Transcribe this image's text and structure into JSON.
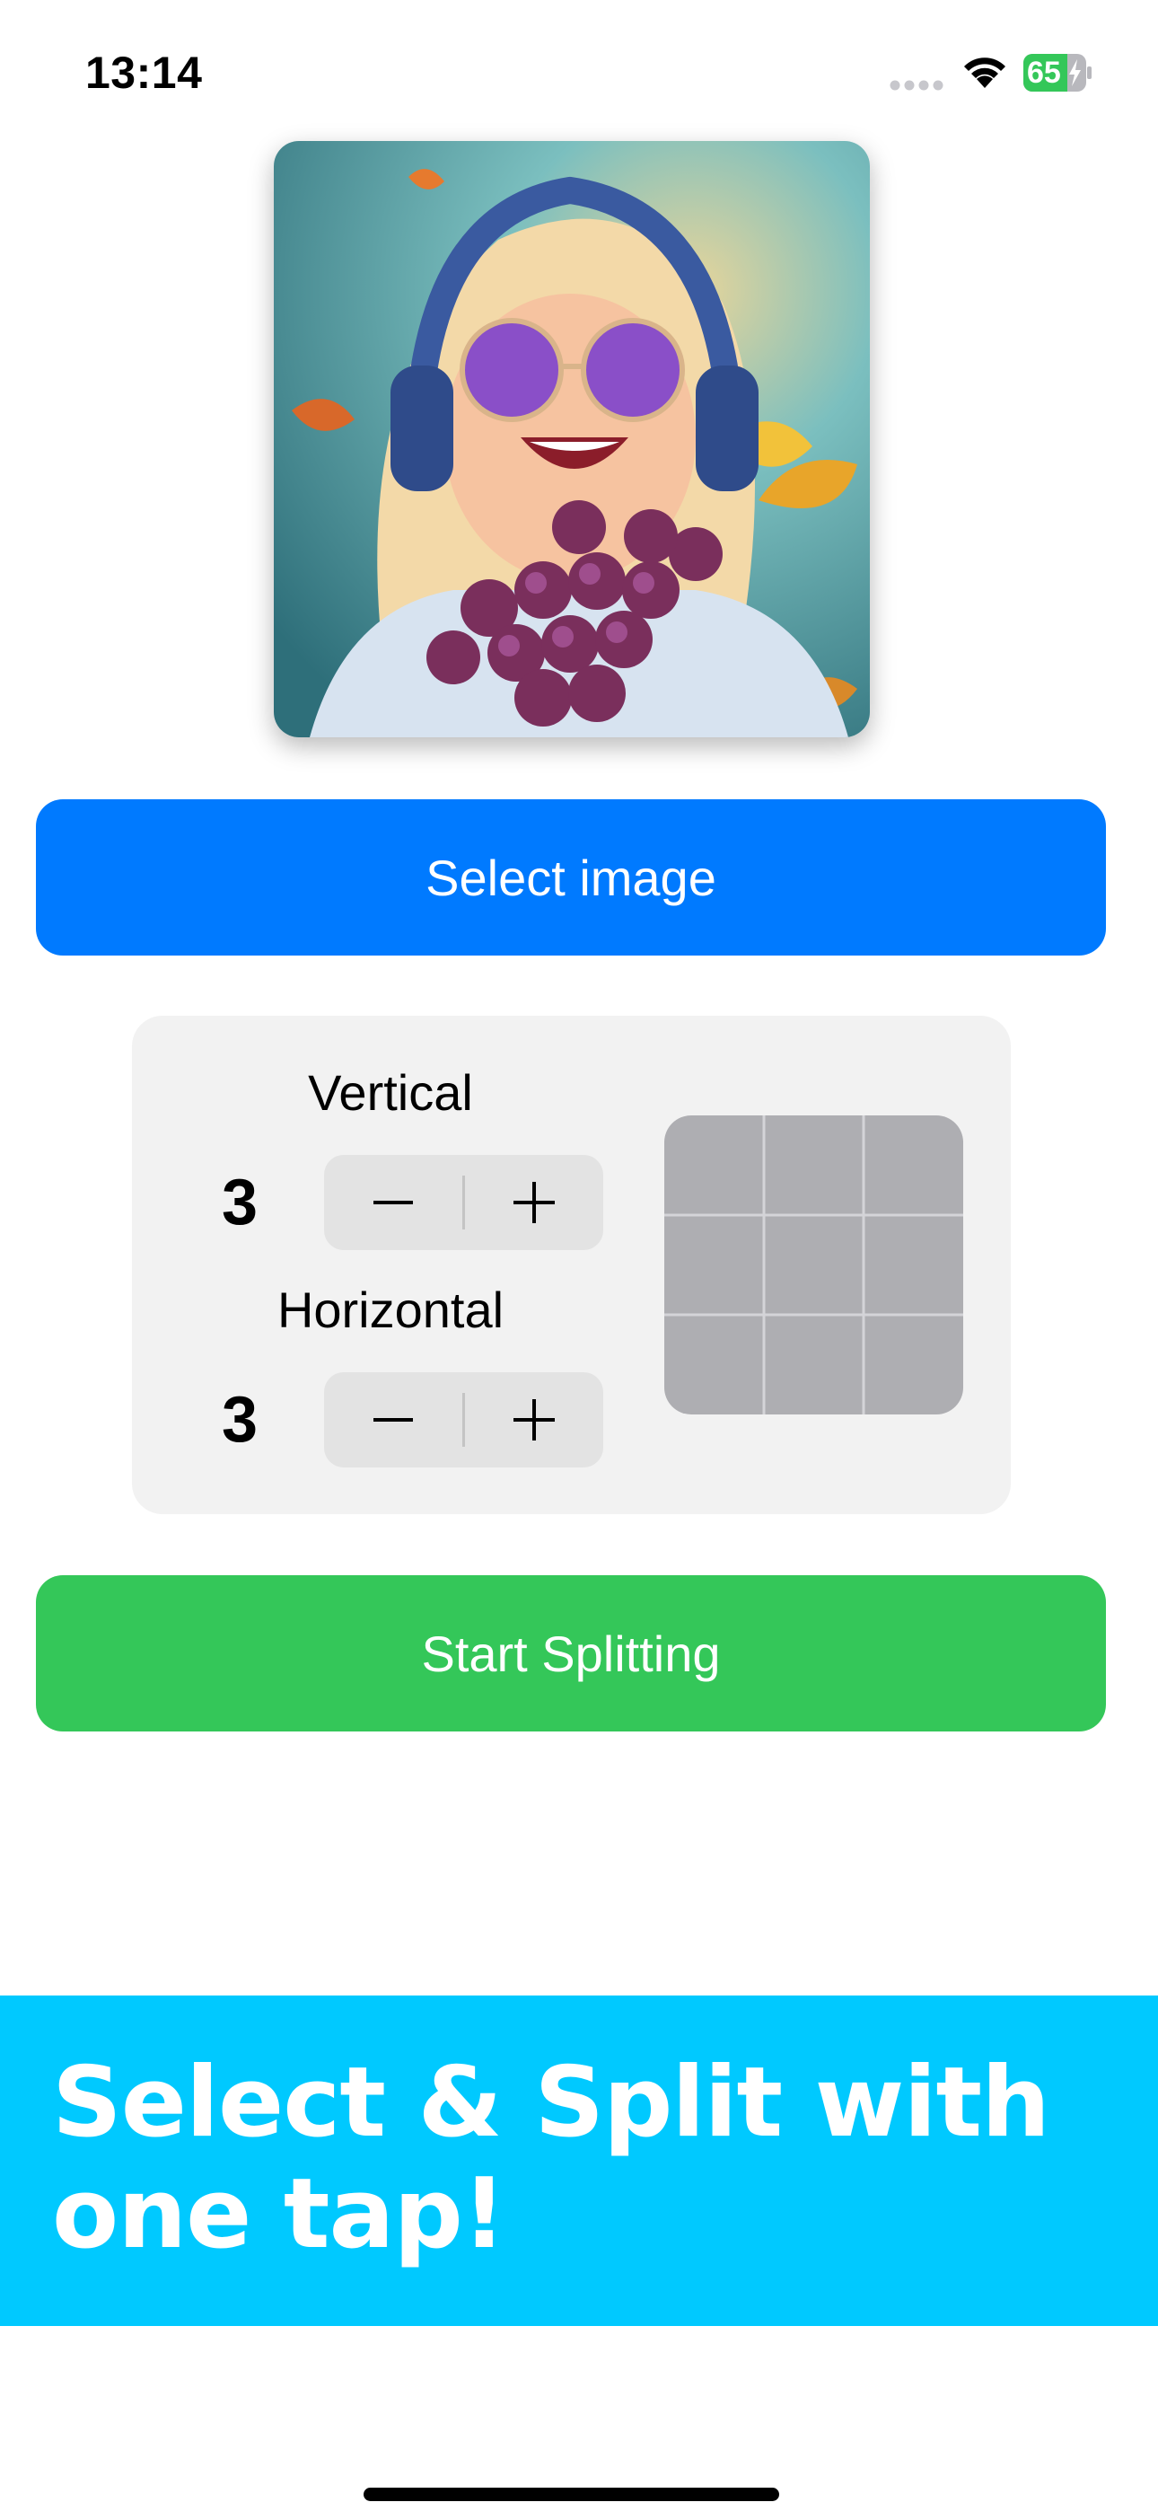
{
  "status_bar": {
    "time": "13:14",
    "battery_level": "65",
    "icons": [
      "cellular-signal-icon",
      "wifi-icon",
      "battery-charging-icon"
    ]
  },
  "preview": {
    "icon": "selected-image-thumbnail"
  },
  "buttons": {
    "select_image": "Select image",
    "start_splitting": "Start Splitting"
  },
  "grid_settings": {
    "vertical_label": "Vertical",
    "vertical_count": "3",
    "horizontal_label": "Horizontal",
    "horizontal_count": "3",
    "grid_preview_rows": 3,
    "grid_preview_cols": 3
  },
  "banner": {
    "headline": "Select & Split with one tap!"
  },
  "colors": {
    "primary_button": "#007aff",
    "start_button": "#34c759",
    "banner": "#00c9ff",
    "battery": "#34c759"
  }
}
